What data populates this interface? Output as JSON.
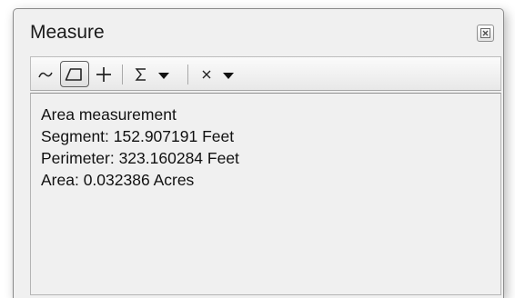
{
  "window": {
    "title": "Measure"
  },
  "toolbar": {
    "tools": [
      {
        "icon": "measure-line-icon",
        "pressed": false
      },
      {
        "icon": "measure-area-icon",
        "pressed": true
      },
      {
        "icon": "measure-feature-icon",
        "pressed": false
      },
      {
        "icon": "sum-icon",
        "dropdown": true
      },
      {
        "icon": "clear-icon",
        "dropdown": true
      }
    ]
  },
  "results": {
    "heading": "Area measurement",
    "segment": "Segment: 152.907191 Feet",
    "perimeter": "Perimeter: 323.160284 Feet",
    "area": "Area: 0.032386 Acres"
  }
}
